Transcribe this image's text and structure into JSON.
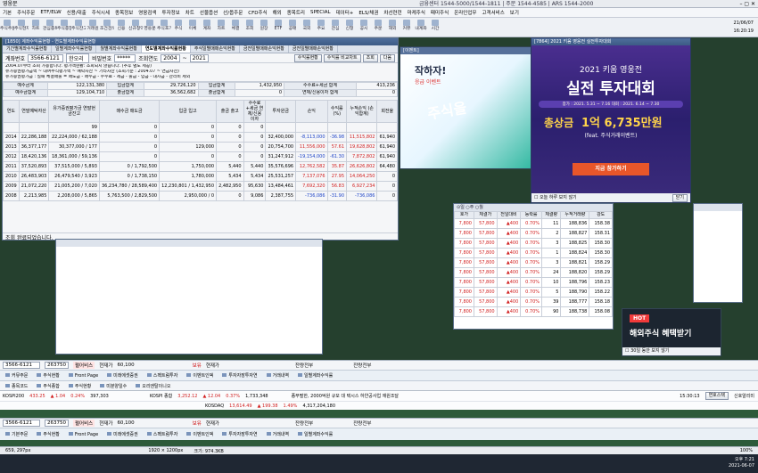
{
  "window": {
    "title": "영웅문",
    "right_info": "금융센터 1544-5000/1544-1811 | 주문 1544-4585 | ARS 1544-2000"
  },
  "menu": [
    "기본",
    "주식주문",
    "ETF/ELW",
    "신용/대출",
    "주식시세",
    "종목정보",
    "영웅검색",
    "투자정보",
    "차트",
    "선물옵션",
    "선/옵주문",
    "CFD주식",
    "해외",
    "종목트리",
    "SPECIAL",
    "데이터+",
    "ELS/채권",
    "차선련런",
    "마케주식",
    "패미주식",
    "온라인업무",
    "고객서비스",
    "보기"
  ],
  "toolbar": [
    "주식주문",
    "주식현재가",
    "차트",
    "관심종목",
    "주식종합",
    "주식잔고",
    "거래원",
    "조건검색",
    "신용",
    "신규청약",
    "영웅문",
    "주식호가",
    "주식",
    "이체",
    "계좌",
    "차트",
    "체결",
    "조회",
    "원장",
    "ETF",
    "공매",
    "국외",
    "주요",
    "관심",
    "신청",
    "공시",
    "주문",
    "해외",
    "커뮤",
    "내계좌",
    "시간"
  ],
  "clock": {
    "date": "21/06/07",
    "time": "16:20:19"
  },
  "main_win": {
    "title": "[1850] 계좌수익률현황 - 연도별계좌수익률현황",
    "tabs": [
      "기간별계좌수익률현황",
      "일별계좌수익률현황",
      "월별계좌수익률현황",
      "연도별계좌수익률현황",
      "주식일별매매손익현황",
      "금전일별매매손익현황",
      "금전일별매매손익현황"
    ],
    "account_label": "계좌번호",
    "account": "3566-6121",
    "owner": "한오리",
    "pw_label": "비밀번호",
    "pw": "*****",
    "period_label": "조회연도",
    "from": "2004",
    "to": "2021",
    "buttons": [
      "수익률현황",
      "수익률 비교차트",
      "조회",
      "다음"
    ],
    "notes": [
      "2004.07부터 조회 가능합니다. 평가액현황: 조회되지 않습니다. (추후 별도 제공)",
      "유가증권평가금액 ~ 대여주식평가액 ~ 예탁자산 ~ 기타자산 (조회기준 : 2004.07 ~ 연금자산)",
      "유가증권평가금 : 실패 체결매출 = 매도금 - 매수금 - 수수료 - 세금 - 출금 - 입금 - 대차금 - 관리비 제외"
    ],
    "summary": [
      [
        "예수금계",
        "122,131,380",
        "입금합계",
        "29,726,120",
        "입금합계",
        "1,432,950",
        "수수료+세금 합계",
        "413,236"
      ],
      [
        "예수금합계",
        "129,104,710",
        "출금합계",
        "36,562,682",
        "출금합계",
        "0",
        "연체/신용이자 합계",
        "0"
      ]
    ],
    "headers": [
      "연도",
      "연말예탁자산",
      "유가증권평가금 연말현금잔고",
      "매수금 매도금",
      "입금 입고",
      "출금 출고",
      "수수료+세금 연체/신용이자",
      "투자원금",
      "손익",
      "수익률(%)",
      "누적손익 (손익합계)",
      "회전율"
    ],
    "rows": [
      [
        "",
        "",
        "99",
        "0",
        "0",
        "0",
        "0",
        "",
        "",
        "",
        "",
        ""
      ],
      [
        "2014",
        "22,286,188",
        "22,224,000 / 62,188",
        "0",
        "0",
        "0",
        "0",
        "32,400,000",
        "-8,113,000",
        "-36.98",
        "11,515,802",
        "61,940"
      ],
      [
        "2013",
        "36,377,177",
        "30,377,000 / 177",
        "0",
        "129,000",
        "0",
        "0",
        "20,754,700",
        "11,556,000",
        "57.61",
        "19,628,802",
        "61,940"
      ],
      [
        "2012",
        "18,420,136",
        "18,361,000 / 59,136",
        "0",
        "0",
        "0",
        "0",
        "31,247,912",
        "-19,154,000",
        "-61.30",
        "7,872,802",
        "61,940"
      ],
      [
        "2011",
        "37,520,893",
        "37,515,000 / 5,893",
        "0 / 1,792,500",
        "1,750,000",
        "5,440",
        "5,440",
        "35,576,696",
        "12,762,582",
        "35.87",
        "26,626,802",
        "64,480"
      ],
      [
        "2010",
        "26,483,903",
        "26,479,540 / 3,923",
        "0 / 1,738,150",
        "1,780,000",
        "5,434",
        "5,434",
        "25,531,257",
        "7,137,076",
        "27.95",
        "14,064,250",
        "0"
      ],
      [
        "2009",
        "21,072,220",
        "21,005,200 / 7,020",
        "36,234,780 / 28,589,400",
        "12,230,801 / 1,432,950",
        "2,482,950",
        "95,630",
        "13,484,461",
        "7,692,320",
        "56.83",
        "6,927,234",
        "0"
      ],
      [
        "2008",
        "2,213,985",
        "2,208,000 / 5,865",
        "5,763,500 / 2,829,500",
        "2,950,000 / 0",
        "0",
        "9,086",
        "2,387,755",
        "-736,086",
        "-31.90",
        "-736,086",
        "0"
      ]
    ],
    "footer": "조회 완료되었습니다."
  },
  "event_win": {
    "title": "[7864] 2021 키움 영웅전 실전투자대회",
    "top_text": "2021 키움 영웅전",
    "main_text": "실전 투자대회",
    "dates": "참가 : 2021. 5.31 ~ 7.16   대회 : 2021. 6.14 ~ 7.30",
    "prize_label": "총상금",
    "prize": "1억 6,735만원",
    "prize_sub": "(feat. 주식거래이벤트)",
    "cta": "지금 참가하기",
    "checkbox": "오늘 하루 보지 않기",
    "close": "닫기"
  },
  "promo": {
    "text1": "주식을",
    "text2": "작하자!",
    "text3": "응급 이벤트"
  },
  "orderbook": {
    "headers": [
      "호가",
      "체결가",
      "전일대비",
      "등락률",
      "체결량",
      "누적거래량",
      "강도"
    ],
    "rows": [
      [
        "7,800",
        "57,800",
        "▲",
        "400",
        "0.70%",
        "11",
        "188,836",
        "158.38"
      ],
      [
        "7,800",
        "57,800",
        "▲",
        "400",
        "0.70%",
        "2",
        "188,827",
        "158.31"
      ],
      [
        "7,800",
        "57,800",
        "▲",
        "400",
        "0.70%",
        "3",
        "188,825",
        "158.30"
      ],
      [
        "7,800",
        "57,800",
        "▲",
        "400",
        "0.70%",
        "1",
        "188,824",
        "158.30"
      ],
      [
        "7,800",
        "57,800",
        "▲",
        "400",
        "0.70%",
        "3",
        "188,821",
        "158.29"
      ],
      [
        "7,800",
        "57,800",
        "▲",
        "400",
        "0.70%",
        "24",
        "188,820",
        "158.29"
      ],
      [
        "7,800",
        "57,800",
        "▲",
        "400",
        "0.70%",
        "10",
        "188,796",
        "158.23"
      ],
      [
        "7,800",
        "57,800",
        "▲",
        "400",
        "0.70%",
        "5",
        "188,790",
        "158.22"
      ],
      [
        "7,800",
        "57,800",
        "▲",
        "400",
        "0.70%",
        "39",
        "188,777",
        "158.18"
      ],
      [
        "7,800",
        "57,800",
        "▲",
        "400",
        "0.70%",
        "90",
        "188,738",
        "158.08"
      ]
    ]
  },
  "hot_ad": {
    "badge": "HOT",
    "text": "해외주식 혜택받기",
    "checkbox": "30일 동안 보지 않기"
  },
  "order_bar1": {
    "account": "3566-6121",
    "code": "263750",
    "name": "펄어비스",
    "label1": "현재가",
    "price": "60,100",
    "label2": "보유",
    "label3": "현재가",
    "label4": "잔량전부",
    "label5": "잔량전부"
  },
  "quick1": [
    "커뮤주문",
    "주식현황",
    "Front Page",
    "미래에셋증권",
    "스펙트럼투자",
    "이벤트인덱",
    "투자자장투자연",
    "거래내역",
    "일별계좌수익률"
  ],
  "sub1": [
    "종목코드",
    "주식종합",
    "주식현황",
    "미분양일수",
    "오리엔탈이니오"
  ],
  "ticker": {
    "kospi_label": "KOSPI200",
    "kospi": "433.25",
    "kospi_chg": "▲ 1.04",
    "kospi_pct": "0.24%",
    "kospi_vol": "397,303",
    "name1": "KOSPI 종합",
    "val1": "3,252.12",
    "chg1": "▲ 12.04",
    "pct1": "0.37%",
    "vol1": "1,733,348",
    "news": "종부펄한, 2000억원 규모 대 택시스 하얀공사업 재원조달",
    "time": "15:30:13",
    "news_btn": "연호스택",
    "kosdaq_label": "KOSDAQ",
    "kosdaq": "13,614.49",
    "kosdaq_chg": "▲ 199.38",
    "kosdaq_pct": "1.49%",
    "kosdaq_vol": "4,317,204,180",
    "right": "신호알리미"
  },
  "order_bar2": {
    "account": "3566-6121",
    "code": "263750",
    "name": "펄어비스",
    "label1": "현재가",
    "price": "60,100",
    "label2": "보유",
    "label3": "현재가",
    "label4": "잔량전부",
    "label5": "잔량전부"
  },
  "quick2": [
    "기본주문",
    "주식현황",
    "Front Page",
    "미래에셋증권",
    "스펙트럼투자",
    "이벤트인덱",
    "투자자장투자연",
    "거래내역",
    "일별계좌수익률"
  ],
  "status": {
    "pos": "659, 297px",
    "size": "1920 × 1200px",
    "file": "크기: 974.3KB",
    "zoom": "100%"
  },
  "taskbar": {
    "time": "오후 7:21",
    "date": "2021-06-07"
  },
  "colors": {
    "up": "#d21f1f",
    "down": "#1f45c8",
    "accent": "#2d4e7e"
  }
}
